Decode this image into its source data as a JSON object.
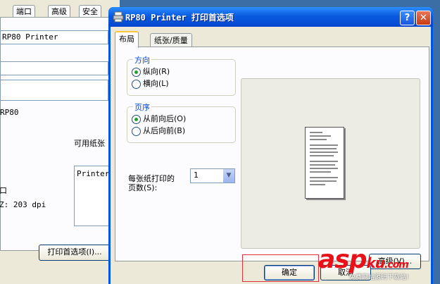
{
  "background_window": {
    "tabs": [
      "端口",
      "高级",
      "安全"
    ],
    "printer_name": "RP80 Printer",
    "model": "RP80",
    "paper_available_label": "可用纸张",
    "paper_list_item": "Printer",
    "ports_prefix": "口",
    "resolution_text": "Z: 203 dpi",
    "print_prefs_button": "打印首选项(I)..."
  },
  "dialog": {
    "title": "RP80 Printer 打印首选项",
    "help_glyph": "?",
    "close_glyph": "✕",
    "tabs": [
      {
        "label": "布局",
        "active": true
      },
      {
        "label": "纸张/质量",
        "active": false
      }
    ],
    "orientation": {
      "label": "方向",
      "options": [
        {
          "label": "纵向(R)",
          "checked": true
        },
        {
          "label": "横向(L)",
          "checked": false
        }
      ]
    },
    "page_order": {
      "label": "页序",
      "options": [
        {
          "label": "从前向后(O)",
          "checked": true
        },
        {
          "label": "从后向前(B)",
          "checked": false
        }
      ]
    },
    "pages_per_sheet": {
      "label_line1": "每张纸打印的",
      "label_line2": "页数(S):",
      "value": "1",
      "arrow": "▼"
    },
    "advanced_button": "高级(V)...",
    "ok_button": "确定",
    "cancel_button": "取消"
  },
  "watermark": {
    "main_a": "asp",
    "main_b": "ku",
    "main_c": ".com",
    "sub": "免费网站源码下载站!"
  },
  "colors": {
    "title_bar": "#0a5be0",
    "dialog_bg": "#ece9d8",
    "group_label": "#0046d5",
    "highlight": "#e0303a",
    "desktop": "#3a6ea5"
  }
}
